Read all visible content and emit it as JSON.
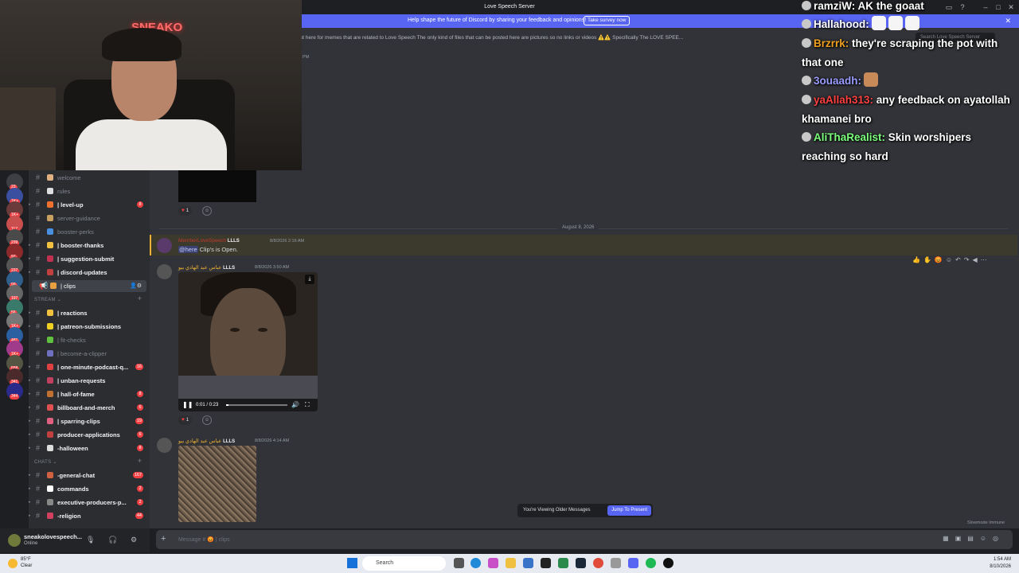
{
  "window": {
    "title": "Love Speech Server"
  },
  "banner": {
    "message": "Help shape the future of Discord by sharing your feedback and opinions!",
    "button": "Take survey now"
  },
  "channel_header": {
    "topic": "rs to share some good memes to make everyone laugh Check out here for memes that are related to Love Speech The only kind of files that can be posted here are pictures so no links or videos ⚠️⚠️ Specifically The LOVE SPEE...",
    "search_placeholder": "Search Love Speech Server",
    "earlier_time": "PM"
  },
  "rail": {
    "badges": [
      "23",
      "1K+",
      "1K+",
      "117",
      "239",
      "97",
      "237",
      "99",
      "197",
      "56",
      "1K+",
      "481",
      "1K+",
      "558",
      "341",
      "344"
    ]
  },
  "sidebar": {
    "channels": [
      {
        "label": "welcome",
        "state": "read"
      },
      {
        "label": "rules",
        "state": "read"
      },
      {
        "label": "| level-up",
        "state": "unread",
        "badge": "8"
      },
      {
        "label": "server-guidance",
        "state": "read"
      },
      {
        "label": "booster-perks",
        "state": "read"
      },
      {
        "label": "| booster-thanks",
        "state": "unread"
      },
      {
        "label": "| suggestion-submit",
        "state": "unread"
      },
      {
        "label": "| discord-updates",
        "state": "unread"
      },
      {
        "label": "| clips",
        "state": "selected"
      }
    ],
    "stream_category": "STREAM",
    "stream_channels": [
      {
        "label": "| reactions",
        "state": "unread"
      },
      {
        "label": "| patreon-submissions",
        "state": "unread"
      },
      {
        "label": "| fit-checks",
        "state": "read"
      },
      {
        "label": "| become-a-clipper",
        "state": "read"
      },
      {
        "label": "| one-minute-podcast-q...",
        "state": "unread",
        "badge": "16"
      },
      {
        "label": "| unban-requests",
        "state": "unread"
      },
      {
        "label": "| hall-of-fame",
        "state": "unread",
        "badge": "8"
      },
      {
        "label": "billboard-and-merch",
        "state": "unread",
        "badge": "6"
      },
      {
        "label": "| sparring-clips",
        "state": "unread",
        "badge": "19"
      },
      {
        "label": "producer-applications",
        "state": "unread",
        "badge": "6"
      },
      {
        "label": "-halloween",
        "state": "unread",
        "badge": "8"
      }
    ],
    "chats_category": "CHATS",
    "chat_channels": [
      {
        "label": "-general-chat",
        "state": "unread",
        "badge": "167"
      },
      {
        "label": "commands",
        "state": "unread",
        "badge": "2"
      },
      {
        "label": "executive-producers-p...",
        "state": "unread",
        "badge": "2"
      },
      {
        "label": "-religion",
        "state": "unread",
        "badge": "44"
      }
    ]
  },
  "user_panel": {
    "username": "sneakolovespeech...",
    "status": "Online"
  },
  "messages": {
    "first_reaction": "1",
    "date_divider": "August 8, 2026",
    "mention": {
      "author": "MemberLoveSpeech",
      "tag": "LLLS",
      "time": "8/8/2026 2:16 AM",
      "text": "Clip's is Open.",
      "at": "@here"
    },
    "video_post": {
      "author": "عباس عبد الهادي بيو",
      "tag": "LLLS",
      "time": "8/8/2026 3:50 AM",
      "video_time": "0:01 / 0:23",
      "progress": 0.04,
      "reaction": "1"
    },
    "image_post": {
      "author": "عباس عبد الهادي بيو",
      "tag": "LLLS",
      "time": "8/8/2026 4:14 AM"
    }
  },
  "older_bar": {
    "text": "You're Viewing Older Messages",
    "button": "Jump To Present"
  },
  "slowmode": "Slowmode Immune",
  "composer": {
    "placeholder": "Message # 😡 | clips"
  },
  "webcam": {
    "neon_sign": "SNEAKO"
  },
  "stream_chat": [
    {
      "user": "ramziW:",
      "text": "AK the goaat",
      "color": "#ffffff"
    },
    {
      "user": "Hallahood:",
      "text": "",
      "color": "#ffffff",
      "emotes": 3
    },
    {
      "user": "Brzrrk:",
      "text": "they're scraping the pot with that one",
      "color": "#f0a020"
    },
    {
      "user": "3ouaadh:",
      "text": "",
      "color": "#9a9cff",
      "face_emote": true
    },
    {
      "user": "yaAllah313:",
      "text": "any feedback on ayatollah khamanei bro",
      "color": "#ff4040"
    },
    {
      "user": "AliThaRealist:",
      "text": "Skin worshipers reaching so hard",
      "color": "#7cff7c"
    }
  ],
  "taskbar": {
    "temp": "85°F",
    "weather": "Clear",
    "search": "Search",
    "time": "1:54 AM",
    "date": "8/10/2026"
  },
  "colors": {
    "accent": "#5865f2",
    "badge": "#f23f43",
    "username_gold": "#f0b232"
  }
}
